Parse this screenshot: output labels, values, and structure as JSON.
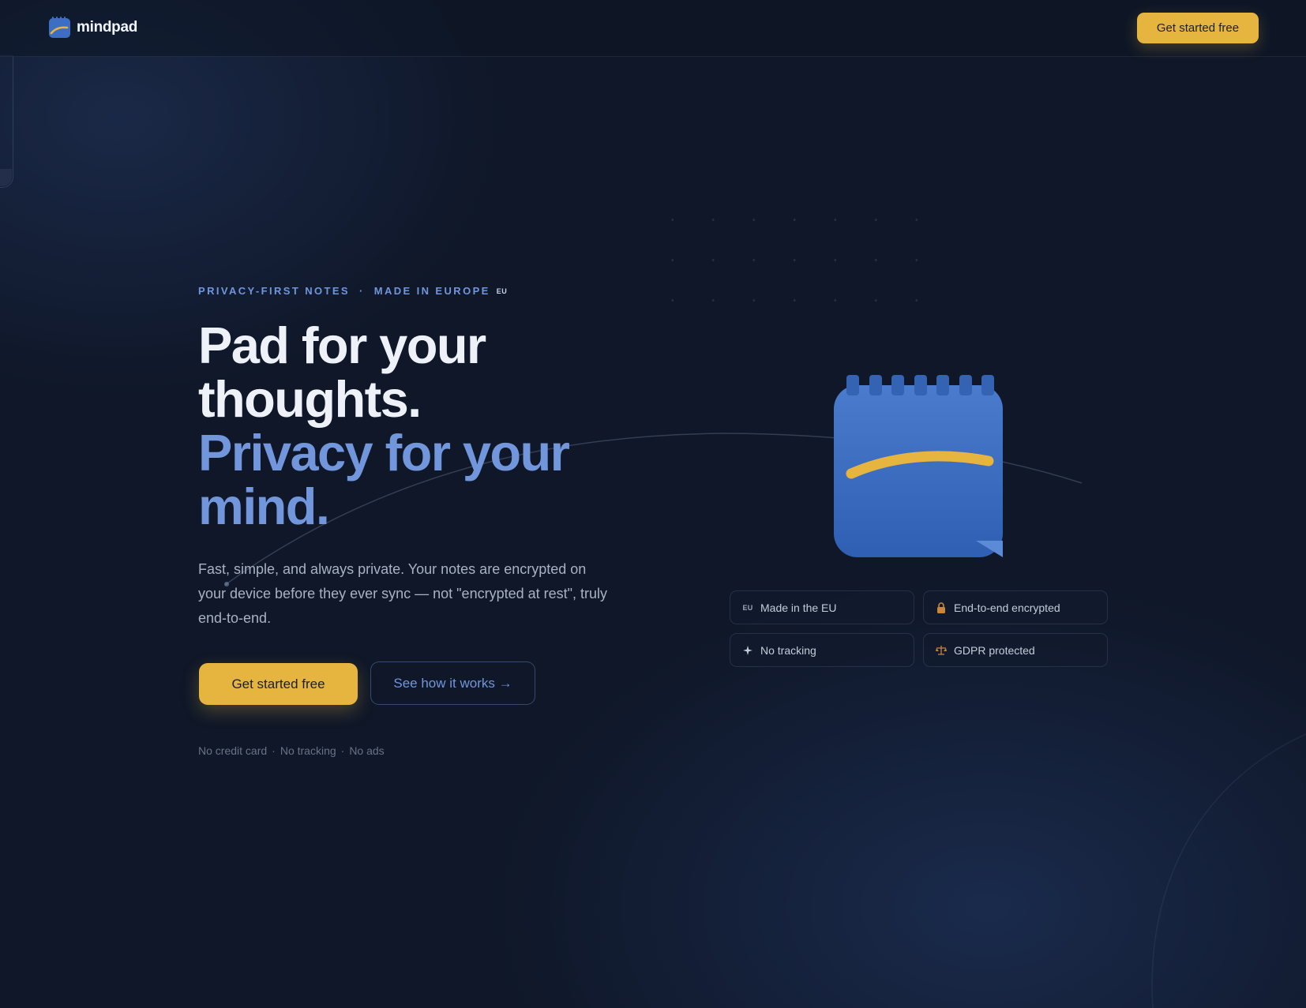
{
  "nav": {
    "brand_name": "mindpad",
    "cta_label": "Get started free"
  },
  "hero": {
    "eyebrow": {
      "part1": "PRIVACY-FIRST NOTES",
      "separator": "·",
      "part2": "MADE IN EUROPE",
      "eu_mark": "EU"
    },
    "headline_line1": "Pad for your",
    "headline_line2": "thoughts.",
    "headline_line3": "Privacy for your",
    "headline_line4": "mind.",
    "lede": "Fast, simple, and always private. Your notes are encrypted on your device before they ever sync — not \"encrypted at rest\", truly end-to-end.",
    "primary_cta": "Get started free",
    "secondary_cta": "See how it works →",
    "footnotes": [
      "No credit card",
      "·",
      "No tracking",
      "·",
      "No ads"
    ]
  },
  "badges": [
    {
      "icon": "eu-icon",
      "icon_text": "EU",
      "label": "Made in the EU"
    },
    {
      "icon": "lock-icon",
      "label": "End-to-end encrypted"
    },
    {
      "icon": "sparkle-icon",
      "label": "No tracking"
    },
    {
      "icon": "scales-icon",
      "label": "GDPR protected"
    }
  ],
  "colors": {
    "background": "#0f1728",
    "accent_yellow": "#e6b540",
    "accent_blue": "#7196dc",
    "notepad_blue": "#3d6ec4"
  }
}
